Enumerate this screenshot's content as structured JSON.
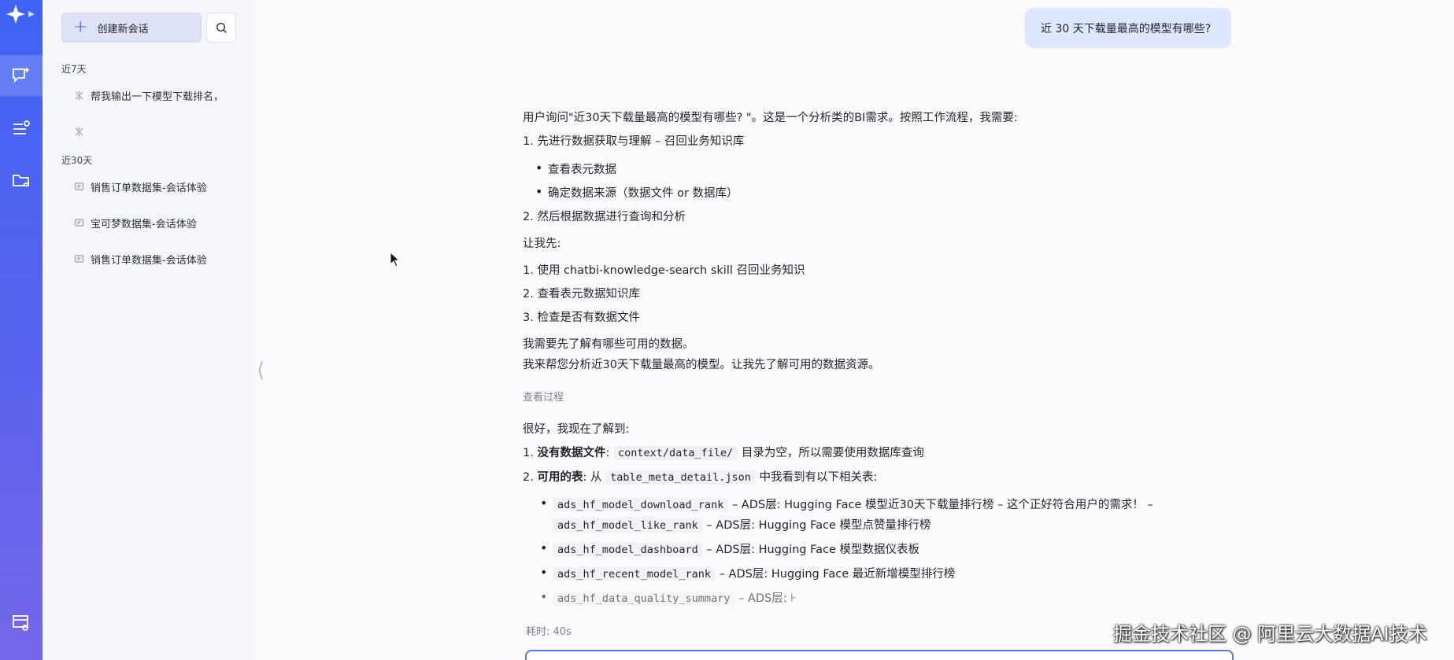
{
  "sidebar": {
    "new_chat_label": "创建新会话",
    "groups": [
      {
        "title": "近7天"
      },
      {
        "title": "近30天"
      }
    ],
    "items": [
      {
        "label": "帮我输出一下模型下载排名，"
      },
      {
        "label": ""
      },
      {
        "label": "销售订单数据集-会话体验"
      },
      {
        "label": "宝可梦数据集-会话体验"
      },
      {
        "label": "销售订单数据集-会话体验"
      }
    ]
  },
  "chat": {
    "user_message": "近 30 天下载量最高的模型有哪些?",
    "assistant": {
      "intro": "用户询问\"近30天下载量最高的模型有哪些? \"。这是一个分析类的BI需求。按照工作流程，我需要:",
      "step1": "1. 先进行数据获取与理解 – 召回业务知识库",
      "step1_b1": "查看表元数据",
      "step1_b2": "确定数据来源（数据文件 or 数据库）",
      "step2": "2. 然后根据数据进行查询和分析",
      "let_me": "让我先:",
      "todo1": "1. 使用 chatbi-knowledge-search skill 召回业务知识",
      "todo2": "2. 查看表元数据知识库",
      "todo3": "3. 检查是否有数据文件",
      "need": "我需要先了解有哪些可用的数据。",
      "summary": "我来帮您分析近30天下载量最高的模型。让我先了解可用的数据资源。",
      "view_process": "查看过程",
      "found_intro": "很好，我现在了解到:",
      "found1_num": "1.",
      "found1_bold": "没有数据文件",
      "found1_colon": ":",
      "found1_code": "context/data_file/",
      "found1_rest": "目录为空，所以需要使用数据库查询",
      "found2_num": "2.",
      "found2_bold": "可用的表",
      "found2_pre": ": 从",
      "found2_code": "table_meta_detail.json",
      "found2_rest": "中我看到有以下相关表:",
      "t1_code": "ads_hf_model_download_rank",
      "t1_desc": "– ADS层: Hugging Face 模型近30天下载量排行榜 – 这个正好符合用户的需求！ –",
      "t1b_code": "ads_hf_model_like_rank",
      "t1b_desc": "– ADS层: Hugging Face 模型点赞量排行榜",
      "t2_code": "ads_hf_model_dashboard",
      "t2_desc": "– ADS层: Hugging Face 模型数据仪表板",
      "t3_code": "ads_hf_recent_model_rank",
      "t3_desc": "– ADS层: Hugging Face 最近新增模型排行榜",
      "t4_code": "ads_hf_data_quality_summary",
      "t4_desc": "– ADS层: ⊦",
      "elapsed": "耗时: 40s"
    }
  },
  "watermark": "掘金技术社区 @ 阿里云大数据AI技术",
  "colors": {
    "accent": "#3f63f5",
    "bubble": "#dfe6ff",
    "sidebar": "#f5f6fa"
  }
}
